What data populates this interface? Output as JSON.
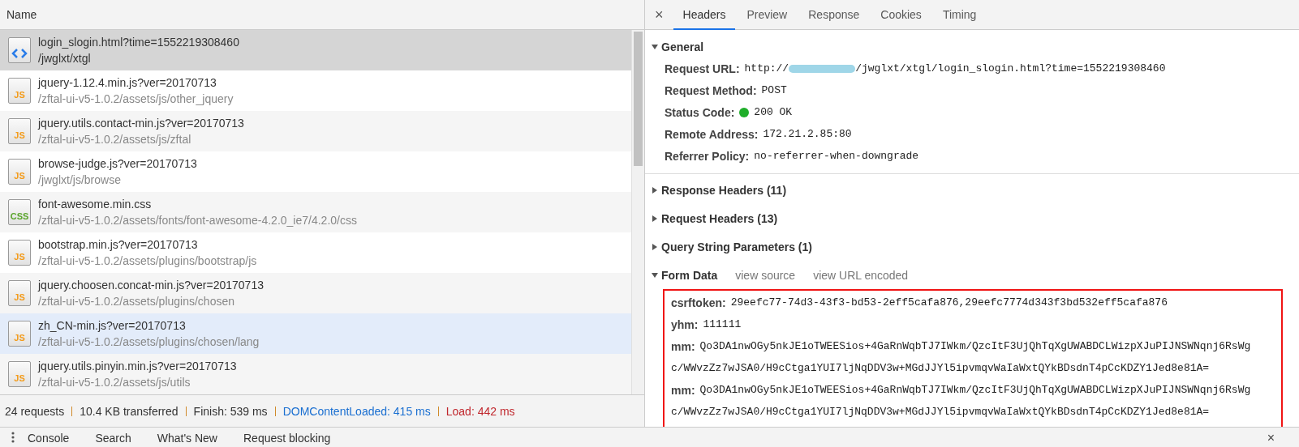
{
  "request_list": {
    "column": "Name",
    "rows": [
      {
        "name": "login_slogin.html?time=1552219308460",
        "path": "/jwglxt/xtgl",
        "kind": "html",
        "selected": true,
        "hovered": false
      },
      {
        "name": "jquery-1.12.4.min.js?ver=20170713",
        "path": "/zftal-ui-v5-1.0.2/assets/js/other_jquery",
        "kind": "js",
        "icon_label": "JS",
        "selected": false,
        "hovered": false
      },
      {
        "name": "jquery.utils.contact-min.js?ver=20170713",
        "path": "/zftal-ui-v5-1.0.2/assets/js/zftal",
        "kind": "js",
        "icon_label": "JS",
        "selected": false,
        "hovered": false
      },
      {
        "name": "browse-judge.js?ver=20170713",
        "path": "/jwglxt/js/browse",
        "kind": "js",
        "icon_label": "JS",
        "selected": false,
        "hovered": false
      },
      {
        "name": "font-awesome.min.css",
        "path": "/zftal-ui-v5-1.0.2/assets/fonts/font-awesome-4.2.0_ie7/4.2.0/css",
        "kind": "css",
        "icon_label": "CSS",
        "selected": false,
        "hovered": false
      },
      {
        "name": "bootstrap.min.js?ver=20170713",
        "path": "/zftal-ui-v5-1.0.2/assets/plugins/bootstrap/js",
        "kind": "js",
        "icon_label": "JS",
        "selected": false,
        "hovered": false
      },
      {
        "name": "jquery.choosen.concat-min.js?ver=20170713",
        "path": "/zftal-ui-v5-1.0.2/assets/plugins/chosen",
        "kind": "js",
        "icon_label": "JS",
        "selected": false,
        "hovered": false
      },
      {
        "name": "zh_CN-min.js?ver=20170713",
        "path": "/zftal-ui-v5-1.0.2/assets/plugins/chosen/lang",
        "kind": "js",
        "icon_label": "JS",
        "selected": false,
        "hovered": true
      },
      {
        "name": "jquery.utils.pinyin.min.js?ver=20170713",
        "path": "/zftal-ui-v5-1.0.2/assets/js/utils",
        "kind": "js",
        "icon_label": "JS",
        "selected": false,
        "hovered": false
      }
    ]
  },
  "status_bar": [
    {
      "text": "24 requests",
      "color": "#333333"
    },
    {
      "text": "10.4 KB transferred",
      "color": "#333333"
    },
    {
      "text": "Finish: 539 ms",
      "color": "#333333"
    },
    {
      "text": "DOMContentLoaded: 415 ms",
      "color": "#1a6fd1"
    },
    {
      "text": "Load: 442 ms",
      "color": "#c0272d"
    }
  ],
  "detail": {
    "close": "×",
    "tabs": [
      {
        "label": "Headers",
        "selected": true
      },
      {
        "label": "Preview",
        "selected": false
      },
      {
        "label": "Response",
        "selected": false
      },
      {
        "label": "Cookies",
        "selected": false
      },
      {
        "label": "Timing",
        "selected": false
      }
    ],
    "sections": [
      {
        "title": "General",
        "expanded": true,
        "kind": "headers",
        "rows": [
          {
            "kind": "url",
            "key": "Request URL:",
            "value": "http://",
            "value_tail": "/jwglxt/xtgl/login_slogin.html?time=1552219308460"
          },
          {
            "kind": "plain",
            "key": "Request Method:",
            "value": "POST"
          },
          {
            "kind": "status",
            "key": "Status Code:",
            "value": "200 OK"
          },
          {
            "kind": "plain",
            "key": "Remote Address:",
            "value": "172.21.2.85:80"
          },
          {
            "kind": "plain",
            "key": "Referrer Policy:",
            "value": "no-referrer-when-downgrade"
          }
        ]
      },
      {
        "title": "Response Headers (11)",
        "expanded": false,
        "kind": "headers"
      },
      {
        "title": "Request Headers (13)",
        "expanded": false,
        "kind": "headers"
      },
      {
        "title": "Query String Parameters (1)",
        "expanded": false,
        "kind": "headers"
      },
      {
        "title": "Form Data",
        "expanded": true,
        "kind": "form",
        "links": [
          "view source",
          "view URL encoded"
        ],
        "params": [
          {
            "key": "csrftoken:",
            "lines": [
              "29eefc77-74d3-43f3-bd53-2eff5cafa876,29eefc7774d343f3bd532eff5cafa876"
            ]
          },
          {
            "key": "yhm:",
            "lines": [
              "111111"
            ]
          },
          {
            "key": "mm:",
            "lines": [
              "Qo3DA1nwOGy5nkJE1oTWEESios+4GaRnWqbTJ7IWkm/QzcItF3UjQhTqXgUWABDCLWizpXJuPIJNSWNqnj6RsWg",
              "c/WWvzZz7wJSA0/H9cCtga1YUI7ljNqDDV3w+MGdJJYl5ipvmqvWaIaWxtQYkBDsdnT4pCcKDZY1Jed8e81A="
            ]
          },
          {
            "key": "mm:",
            "lines": [
              "Qo3DA1nwOGy5nkJE1oTWEESios+4GaRnWqbTJ7IWkm/QzcItF3UjQhTqXgUWABDCLWizpXJuPIJNSWNqnj6RsWg",
              "c/WWvzZz7wJSA0/H9cCtga1YUI7ljNqDDV3w+MGdJJYl5ipvmqvWaIaWxtQYkBDsdnT4pCcKDZY1Jed8e81A="
            ]
          }
        ]
      }
    ]
  },
  "drawer": {
    "tabs": [
      "Console",
      "Search",
      "What's New",
      "Request blocking"
    ],
    "close": "×"
  }
}
